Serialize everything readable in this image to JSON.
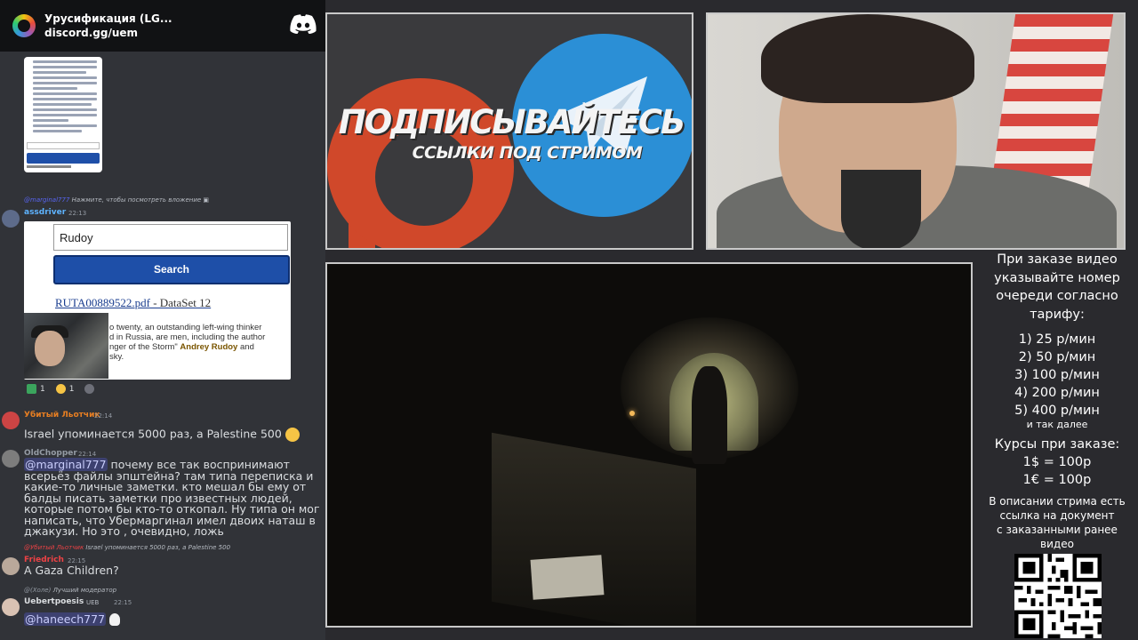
{
  "server": {
    "name": "Урусификация (LG...",
    "invite": "discord.gg/uem"
  },
  "messages": {
    "reply1": {
      "user": "@marginal777",
      "text": "Нажмите, чтобы посмотреть вложение"
    },
    "m1": {
      "user": "assdriver",
      "time": "22:13"
    },
    "search_embed": {
      "input_value": "Rudoy",
      "button_label": "Search",
      "result_link": "RUTA00889522.pdf",
      "result_meta": " - DataSet 12",
      "snippet_1": "o twenty, an outstanding left-wing thinker",
      "snippet_2": "d in Russia, are men, including the author",
      "snippet_3_pre": "nger of the Storm\" ",
      "snippet_3_name": "Andrey Rudoy",
      "snippet_3_post": " and",
      "snippet_4": "sky."
    },
    "reactions": [
      {
        "emoji": "green-flag-emoji",
        "count": "1"
      },
      {
        "emoji": "laughing-emoji",
        "count": "1"
      }
    ],
    "m2": {
      "user": "Убитый Льотчик",
      "time": "22:14",
      "text": "Israel упоминается 5000 раз, а Palestine 500"
    },
    "m3": {
      "user": "OldChopper",
      "time": "22:14",
      "mention": "@marginal777",
      "text": " почему все так воспринимают всерьёз файлы эпштейна? там типа переписка и какие-то личные заметки. кто мешал бы ему от балды писать заметки про известных людей, которые потом бы кто-то откопал. Ну типа он мог написать, что Убермаргинал имел двоих наташ в джакузи. Но это , очевидно, ложь"
    },
    "reply2": {
      "user": "@Убитый Льотчик",
      "text": "Israel упоминается 5000 раз, а Palestine 500"
    },
    "m4": {
      "user": "Friedrich",
      "time": "22:15",
      "text": "A Gaza Children?"
    },
    "reply3": {
      "user": "@(Холе)",
      "text": "Лучший модератор"
    },
    "m5": {
      "user": "Uebertpoesis",
      "tag": "UEB",
      "time": "22:15",
      "mention": "@haneech777"
    }
  },
  "banner": {
    "headline": "ПОДПИСЫВАЙТЕСЬ",
    "subline": "ССЫЛКИ ПОД СТРИМОМ"
  },
  "tariff": {
    "head": [
      "При заказе видео",
      "указывайте номер",
      "очереди согласно",
      "тарифу:"
    ],
    "rates": [
      "1) 25 р/мин",
      "2) 50 р/мин",
      "3) 100 р/мин",
      "4) 200 р/мин",
      "5) 400 р/мин"
    ],
    "more": "и так далее",
    "courses": [
      "Курсы при заказе:",
      "1$ = 100р",
      "1€ = 100р"
    ],
    "note": [
      "В описании стрима есть",
      "ссылка на документ",
      "с заказанными ранее",
      "видео"
    ]
  },
  "colors": {
    "discord_bg": "#313338",
    "header_bg": "#111214",
    "search_button": "#1e4fa8",
    "name_orange": "#e67e22",
    "name_gray": "#949ba4",
    "name_red": "#ed4245",
    "name_blue": "#4aa3ff"
  }
}
